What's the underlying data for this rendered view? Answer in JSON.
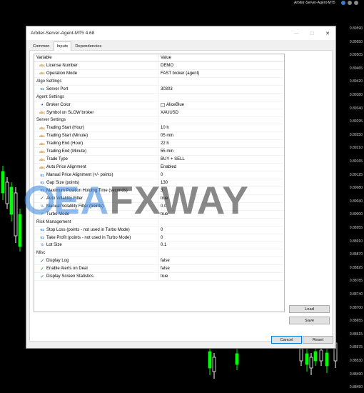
{
  "chart": {
    "title": "Arbiter-Server-Agent-MT5",
    "prices": [
      "0.89590",
      "0.89550",
      "0.89505",
      "0.89465",
      "0.89420",
      "0.89380",
      "0.89340",
      "0.89295",
      "0.89250",
      "0.89210",
      "0.89165",
      "0.89125",
      "0.89080",
      "0.89040",
      "0.89000",
      "0.88955",
      "0.88910",
      "0.88870",
      "0.88825",
      "0.88785",
      "0.88740",
      "0.88700",
      "0.88655",
      "0.88615",
      "0.88575",
      "0.88530",
      "0.88490",
      "0.88450"
    ],
    "bull_color": "#00ff00",
    "bear_color": "#ffffff"
  },
  "dialog": {
    "title": "Arbiter-Server-Agent-MT5 4.68",
    "window_controls": {
      "minimize": "—",
      "maximize": "☐",
      "close": "✕"
    },
    "tabs": [
      {
        "label": "Common",
        "active": false
      },
      {
        "label": "Inputs",
        "active": true
      },
      {
        "label": "Dependencies",
        "active": false
      }
    ],
    "grid": {
      "col_variable": "Variable",
      "col_value": "Value",
      "rows": [
        {
          "icon": "abc",
          "name": "License Number",
          "value": "DEMO"
        },
        {
          "icon": "abc",
          "name": "Operation Mode",
          "value": "FAST broker (agent)"
        },
        {
          "group": true,
          "name": "Algo Settings",
          "value": ""
        },
        {
          "icon": "01",
          "name": "Server Port",
          "value": "30303"
        },
        {
          "group": true,
          "name": "Agent Settings",
          "value": ""
        },
        {
          "icon": "pal",
          "name": "Broker Color",
          "value": "AliceBlue",
          "swatch": true
        },
        {
          "icon": "abc",
          "name": "Symbol on SLOW broker",
          "value": "XAUUSD"
        },
        {
          "group": true,
          "name": "Server Settings",
          "value": ""
        },
        {
          "icon": "abc",
          "name": "Trading Start (Hour)",
          "value": "10 h"
        },
        {
          "icon": "abc",
          "name": "Trading Start (Minute)",
          "value": "05 min"
        },
        {
          "icon": "abc",
          "name": "Trading End (Hour)",
          "value": "22 h"
        },
        {
          "icon": "abc",
          "name": "Trading End (Minute)",
          "value": "55 min"
        },
        {
          "icon": "abc",
          "name": "Trade Type",
          "value": "BUY + SELL"
        },
        {
          "icon": "abc",
          "name": "Auto Price Alignment",
          "value": "Enabled"
        },
        {
          "icon": "01",
          "name": "Manual Price Alignment (+/- points)",
          "value": "0"
        },
        {
          "icon": "01",
          "name": "Gap Size (points)",
          "value": "130"
        },
        {
          "icon": "01",
          "name": "Maximum Position Holding Time (seconds)",
          "value": "3"
        },
        {
          "icon": "chk",
          "name": "Auto Volatility Filter",
          "value": "true"
        },
        {
          "icon": "half",
          "name": "Manual Volatility Filter (points)",
          "value": "0.0"
        },
        {
          "icon": "chk",
          "name": "Turbo Mode",
          "value": "true"
        },
        {
          "group": true,
          "name": "Risk Management",
          "value": ""
        },
        {
          "icon": "01",
          "name": "Stop Loss (points - not used in Turbo Mode)",
          "value": "0"
        },
        {
          "icon": "01",
          "name": "Take Profit (points - not used in Turbo Mode)",
          "value": "0"
        },
        {
          "icon": "half",
          "name": "Lot Size",
          "value": "0.1"
        },
        {
          "group": true,
          "name": "Misc",
          "value": ""
        },
        {
          "icon": "chk",
          "name": "Display Log",
          "value": "false"
        },
        {
          "icon": "chk",
          "name": "Enable Alerts on Deal",
          "value": "false"
        },
        {
          "icon": "chk",
          "name": "Display Screen Statistics",
          "value": "true"
        }
      ]
    },
    "buttons": {
      "load": "Load",
      "save": "Save",
      "cancel": "Cancel",
      "reset": "Reset"
    }
  },
  "watermark": {
    "prefix": "EA",
    "suffix": "FXWAY"
  }
}
